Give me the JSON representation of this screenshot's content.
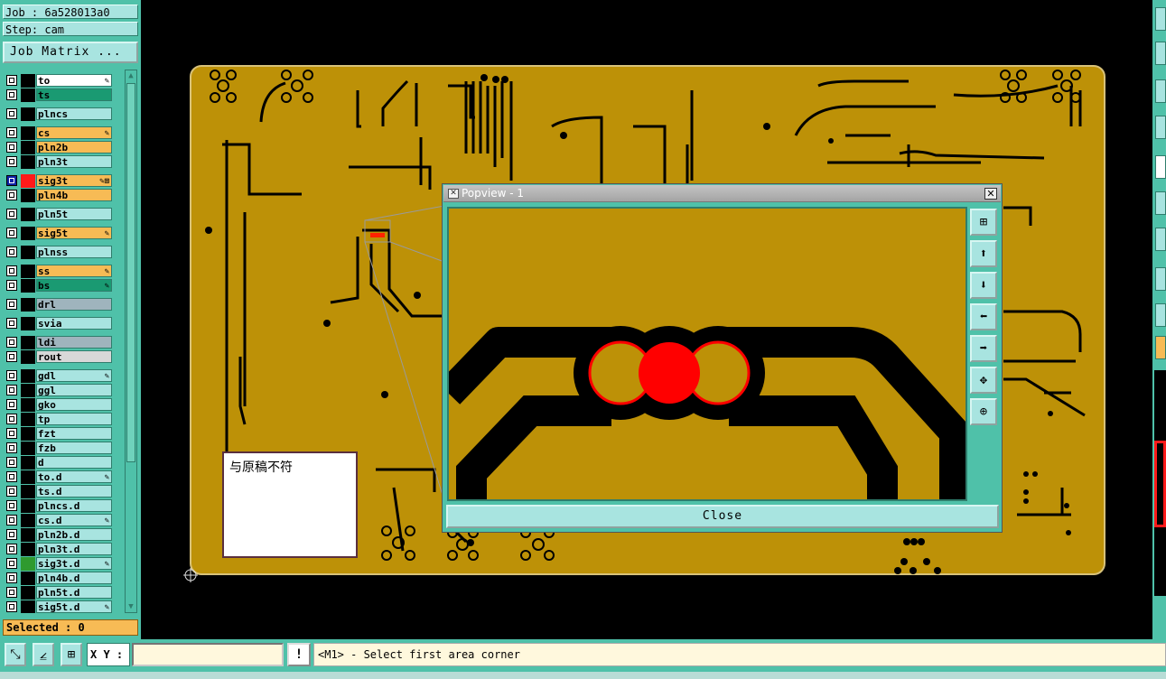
{
  "job_label": "Job : 6a528013a0",
  "step_label": "Step: cam",
  "job_matrix_button": "Job Matrix ...",
  "layers": [
    {
      "name": "to",
      "color": "#000000",
      "name_bg": "#ffffff",
      "flag": "✎"
    },
    {
      "name": "ts",
      "color": "#000000",
      "name_bg": "#1a9a72",
      "flag": ""
    },
    {
      "name": "plncs",
      "color": "#000000",
      "name_bg": "#a8e4e0",
      "flag": ""
    },
    {
      "name": "cs",
      "color": "#000000",
      "name_bg": "#f7bb55",
      "flag": "✎"
    },
    {
      "name": "pln2b",
      "color": "#000000",
      "name_bg": "#f7bb55",
      "flag": ""
    },
    {
      "name": "pln3t",
      "color": "#000000",
      "name_bg": "#a8e4e0",
      "flag": ""
    },
    {
      "name": "sig3t",
      "color": "#ff1a1a",
      "name_bg": "#f7bb55",
      "flag": "✎⊞",
      "selected": true
    },
    {
      "name": "pln4b",
      "color": "#000000",
      "name_bg": "#f7bb55",
      "flag": ""
    },
    {
      "name": "pln5t",
      "color": "#000000",
      "name_bg": "#a8e4e0",
      "flag": ""
    },
    {
      "name": "sig5t",
      "color": "#000000",
      "name_bg": "#f7bb55",
      "flag": "✎"
    },
    {
      "name": "plnss",
      "color": "#000000",
      "name_bg": "#a8e4e0",
      "flag": ""
    },
    {
      "name": "ss",
      "color": "#000000",
      "name_bg": "#f7bb55",
      "flag": "✎"
    },
    {
      "name": "bs",
      "color": "#000000",
      "name_bg": "#1a9a72",
      "flag": "✎"
    },
    {
      "name": "drl",
      "color": "#000000",
      "name_bg": "#9fb4bd",
      "flag": ""
    },
    {
      "name": "svia",
      "color": "#000000",
      "name_bg": "#a8e4e0",
      "flag": ""
    },
    {
      "name": "ldi",
      "color": "#000000",
      "name_bg": "#9fb4bd",
      "flag": ""
    },
    {
      "name": "rout",
      "color": "#000000",
      "name_bg": "#d8d8d8",
      "flag": ""
    },
    {
      "name": "gdl",
      "color": "#000000",
      "name_bg": "#a8e4e0",
      "flag": "✎"
    },
    {
      "name": "ggl",
      "color": "#000000",
      "name_bg": "#a8e4e0",
      "flag": ""
    },
    {
      "name": "gko",
      "color": "#000000",
      "name_bg": "#a8e4e0",
      "flag": ""
    },
    {
      "name": "tp",
      "color": "#000000",
      "name_bg": "#a8e4e0",
      "flag": ""
    },
    {
      "name": "fzt",
      "color": "#000000",
      "name_bg": "#a8e4e0",
      "flag": ""
    },
    {
      "name": "fzb",
      "color": "#000000",
      "name_bg": "#a8e4e0",
      "flag": ""
    },
    {
      "name": "d",
      "color": "#000000",
      "name_bg": "#a8e4e0",
      "flag": ""
    },
    {
      "name": "to.d",
      "color": "#000000",
      "name_bg": "#a8e4e0",
      "flag": "✎"
    },
    {
      "name": "ts.d",
      "color": "#000000",
      "name_bg": "#a8e4e0",
      "flag": ""
    },
    {
      "name": "plncs.d",
      "color": "#000000",
      "name_bg": "#a8e4e0",
      "flag": ""
    },
    {
      "name": "cs.d",
      "color": "#000000",
      "name_bg": "#a8e4e0",
      "flag": "✎"
    },
    {
      "name": "pln2b.d",
      "color": "#000000",
      "name_bg": "#a8e4e0",
      "flag": ""
    },
    {
      "name": "pln3t.d",
      "color": "#000000",
      "name_bg": "#a8e4e0",
      "flag": ""
    },
    {
      "name": "sig3t.d",
      "color": "#2f9a2f",
      "name_bg": "#a8e4e0",
      "flag": "✎"
    },
    {
      "name": "pln4b.d",
      "color": "#000000",
      "name_bg": "#a8e4e0",
      "flag": ""
    },
    {
      "name": "pln5t.d",
      "color": "#000000",
      "name_bg": "#a8e4e0",
      "flag": ""
    },
    {
      "name": "sig5t.d",
      "color": "#000000",
      "name_bg": "#a8e4e0",
      "flag": "✎"
    }
  ],
  "selected_label": "Selected : 0",
  "note_text": "与原稿不符",
  "popview": {
    "title": "Popview - 1",
    "close_label": "Close",
    "tools": [
      "zoom-fit-icon",
      "arrow-up-icon",
      "arrow-down-icon",
      "arrow-left-icon",
      "arrow-right-icon",
      "zoom-in-icon",
      "zoom-out-icon"
    ]
  },
  "xy_label": "X Y :",
  "xy_value": "",
  "warn_label": "!",
  "status_message": "<M1> - Select first area corner",
  "colors": {
    "board": "#bd9107",
    "panel": "#4fc1a9",
    "highlight": "#ff0000"
  }
}
